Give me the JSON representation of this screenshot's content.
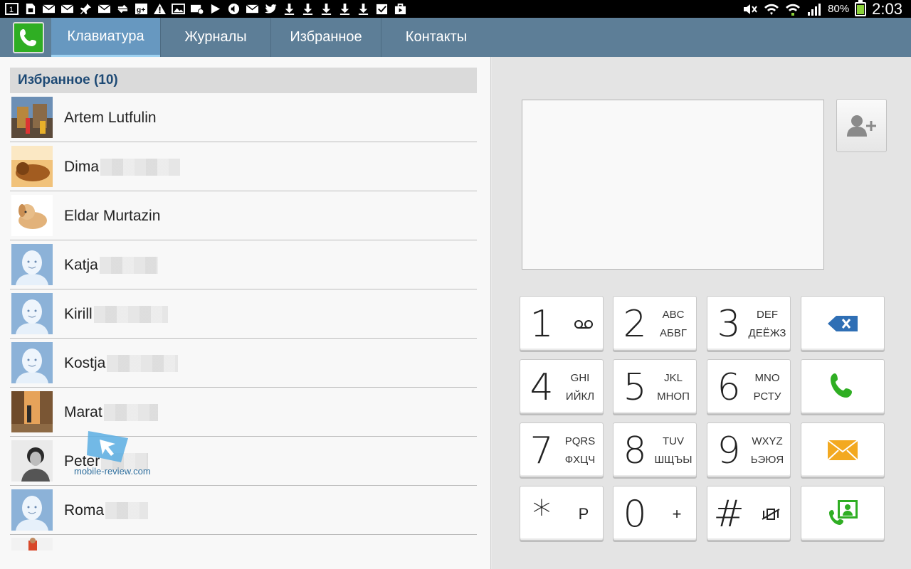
{
  "status_bar": {
    "notification_icons": [
      "sim-1-icon",
      "sim-card-icon",
      "mail-icon",
      "mail-icon",
      "pin-icon",
      "mail-icon",
      "sync-icon",
      "google-plus-icon",
      "warning-icon",
      "image-icon",
      "mail-at-icon",
      "play-icon",
      "volume-icon",
      "mail-icon",
      "twitter-icon",
      "download-icon",
      "download-icon",
      "download-icon",
      "download-icon",
      "download-icon",
      "checkbox-icon",
      "bag-icon"
    ],
    "battery_percent": "80%",
    "time": "2:03"
  },
  "tabs": [
    {
      "label": "Клавиатура",
      "active": true
    },
    {
      "label": "Журналы",
      "active": false
    },
    {
      "label": "Избранное",
      "active": false
    },
    {
      "label": "Контакты",
      "active": false
    }
  ],
  "favorites": {
    "header": "Избранное (10)",
    "contacts": [
      {
        "name": "Artem Lutfulin",
        "avatar": "photo-street"
      },
      {
        "name": "Dima",
        "avatar": "photo-dog"
      },
      {
        "name": "Eldar Murtazin",
        "avatar": "photo-toy-dog"
      },
      {
        "name": "Katja",
        "avatar": "default-person"
      },
      {
        "name": "Kirill",
        "avatar": "default-person"
      },
      {
        "name": "Kostja",
        "avatar": "default-person"
      },
      {
        "name": "Marat",
        "avatar": "photo-street-sunset"
      },
      {
        "name": "Peter",
        "avatar": "photo-person"
      },
      {
        "name": "Roma",
        "avatar": "default-person"
      }
    ]
  },
  "watermark": "mobile-review.com",
  "dialpad": {
    "keys": [
      {
        "digit": "1",
        "l1": "",
        "l2": "",
        "side": "voicemail-icon"
      },
      {
        "digit": "2",
        "l1": "ABC",
        "l2": "АБВГ"
      },
      {
        "digit": "3",
        "l1": "DEF",
        "l2": "ДЕЁЖЗ"
      },
      {
        "digit": "4",
        "l1": "GHI",
        "l2": "ИЙКЛ"
      },
      {
        "digit": "5",
        "l1": "JKL",
        "l2": "МНОП"
      },
      {
        "digit": "6",
        "l1": "MNO",
        "l2": "РСТУ"
      },
      {
        "digit": "7",
        "l1": "PQRS",
        "l2": "ФХЦЧ"
      },
      {
        "digit": "8",
        "l1": "TUV",
        "l2": "ШЩЪЫ"
      },
      {
        "digit": "9",
        "l1": "WXYZ",
        "l2": "ЬЭЮЯ"
      },
      {
        "digit": "*",
        "side_text": "P"
      },
      {
        "digit": "0",
        "side_text": "+"
      },
      {
        "digit": "#",
        "side": "vibrate-mute-icon"
      }
    ],
    "function_keys": [
      "backspace-icon",
      "call-icon",
      "message-icon",
      "video-call-icon"
    ]
  },
  "colors": {
    "tabbar": "#5d7e97",
    "tab_active": "#6798c0",
    "call_green": "#2fae23",
    "header_text": "#1e4a75",
    "backspace_blue": "#2f6fb5",
    "message_orange": "#f3a920"
  }
}
